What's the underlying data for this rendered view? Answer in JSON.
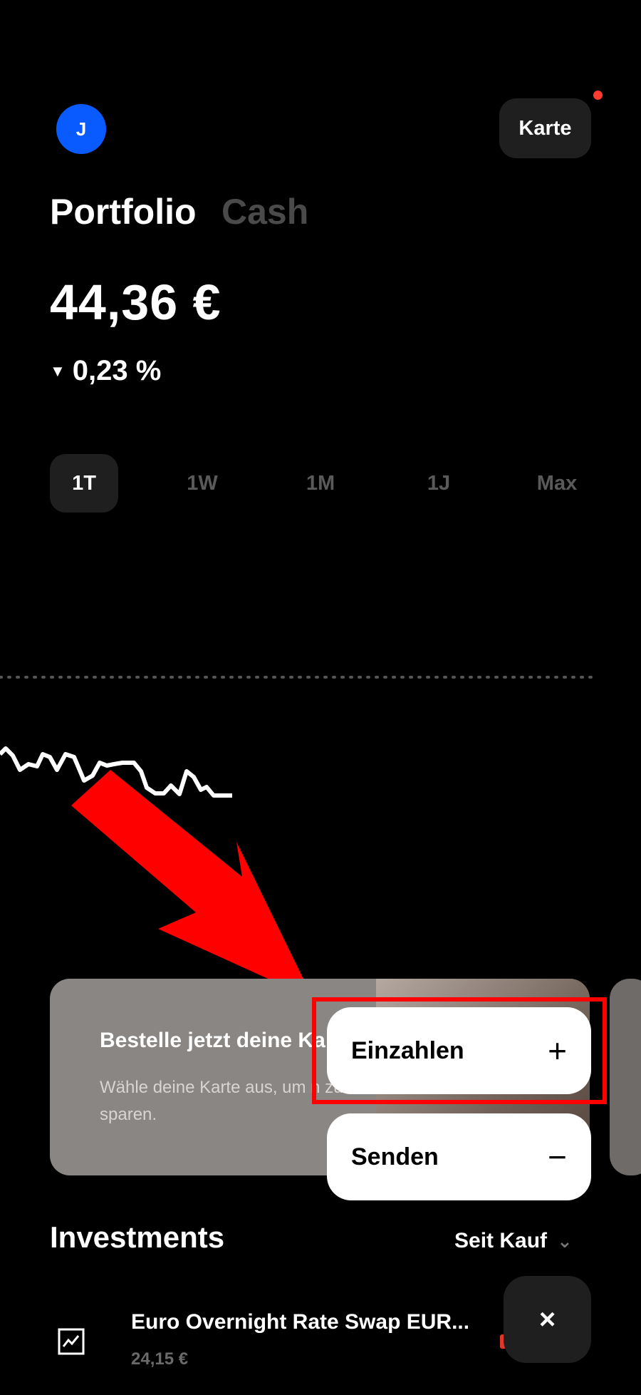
{
  "header": {
    "avatar_initial": "J",
    "card_button_label": "Karte",
    "notification_dot_color": "#ff3b30"
  },
  "tabs": [
    {
      "label": "Portfolio",
      "active": true
    },
    {
      "label": "Cash",
      "active": false
    }
  ],
  "portfolio": {
    "balance": "44,36 €",
    "change_indicator": "▼",
    "change": "0,23 %"
  },
  "range_selector": [
    {
      "label": "1T",
      "active": true
    },
    {
      "label": "1W",
      "active": false
    },
    {
      "label": "1M",
      "active": false
    },
    {
      "label": "1J",
      "active": false
    },
    {
      "label": "Max",
      "active": false
    }
  ],
  "promo_card": {
    "title": "Bestelle jetzt deine Ka",
    "text": "Wähle deine Karte aus, um n zu sparen."
  },
  "actions": {
    "deposit_label": "Einzahlen",
    "deposit_icon": "plus-icon",
    "send_label": "Senden",
    "send_icon": "minus-icon",
    "highlight_color": "#ff0000"
  },
  "investments": {
    "title": "Investments",
    "sort_label": "Seit Kauf",
    "items": [
      {
        "name": "Euro Overnight Rate Swap EUR...",
        "value": "24,15 €",
        "icon": "chart-icon"
      }
    ]
  },
  "fab": {
    "close_symbol": "×"
  },
  "colors": {
    "background": "#000000",
    "accent_blue": "#0a5bff",
    "annotation_red": "#ff0000"
  }
}
